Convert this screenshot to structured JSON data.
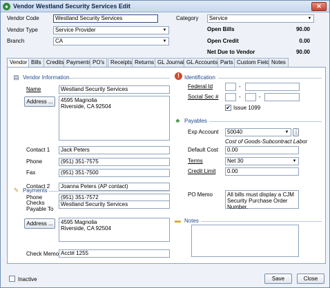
{
  "window": {
    "title": "Vendor Westland Security Services Edit",
    "close_glyph": "✕"
  },
  "header": {
    "vendor_code_label": "Vendor Code",
    "vendor_code_value": "Westland Security Services",
    "vendor_type_label": "Vendor Type",
    "vendor_type_value": "Service Provider",
    "branch_label": "Branch",
    "branch_value": "CA",
    "category_label": "Category",
    "category_value": "Service",
    "open_bills_label": "Open Bills",
    "open_bills_value": "90.00",
    "open_credit_label": "Open Credit",
    "open_credit_value": "0.00",
    "net_due_label": "Net Due to Vendor",
    "net_due_value": "90.00"
  },
  "tabs": [
    "Vendor",
    "Bills",
    "Credits",
    "Payments",
    "PO's",
    "Receipts",
    "Returns",
    "GL Journal",
    "GL Accounts",
    "Parts",
    "Custom Fields",
    "Notes"
  ],
  "vendor_info": {
    "section_title": "Vendor Information",
    "name_label": "Name",
    "name_value": "Westland Security Services",
    "address_button": "Address ...",
    "address_value": "4595 Magnolia\nRiverside, CA  92504",
    "contact1_label": "Contact 1",
    "contact1_value": "Jack Peters",
    "phone_label": "Phone",
    "phone_value": "(951) 351-7575",
    "fax_label": "Fax",
    "fax_value": "(951) 351-7500",
    "contact2_label": "Contact 2",
    "contact2_value": "Joanna Peters (AP contact)",
    "phone2_label": "Phone",
    "phone2_value": "(951) 351-7572"
  },
  "payments": {
    "section_title": "Payments",
    "checks_payable_label_1": "Checks",
    "checks_payable_label_2": "Payable To",
    "checks_payable_value": "Westland Security Services",
    "address_button": "Address ...",
    "address_value": "4595 Magnolia\nRiverside, CA  92504",
    "check_memo_label": "Check Memo",
    "check_memo_value": "Acct# 1255"
  },
  "identification": {
    "section_title": "Identification",
    "federal_id_label": "Federal Id",
    "social_sec_label": "Social Sec #",
    "dash": "-",
    "issue_1099_label": "Issue 1099",
    "issue_1099_checked": "✔"
  },
  "payables": {
    "section_title": "Payables",
    "exp_account_label": "Exp Account",
    "exp_account_value": "50040",
    "exp_account_desc": "Cost of Goods-Subcontract Labor",
    "default_cost_label": "Default Cost",
    "default_cost_value": "0.00",
    "terms_label": "Terms",
    "terms_value": "Net 30",
    "credit_limit_label": "Credit Limit",
    "credit_limit_value": "0.00",
    "po_memo_label": "PO Memo",
    "po_memo_value": "All bills must display a CJM\nSecurity Purchase Order Number."
  },
  "notes": {
    "section_title": "Notes",
    "value": ""
  },
  "footer": {
    "inactive_label": "Inactive",
    "save_button": "Save",
    "close_button": "Close"
  },
  "colors": {
    "section_title": "#1f4a8a",
    "title_bar": "#c7d7ee",
    "close_button": "#c8452f"
  },
  "icons": {
    "app": "green-circle-icon",
    "vendor_info": "vendor-card-icon",
    "identification": "red-alert-icon",
    "payables": "money-icon",
    "payments": "pencil-icon",
    "notes": "note-icon"
  }
}
